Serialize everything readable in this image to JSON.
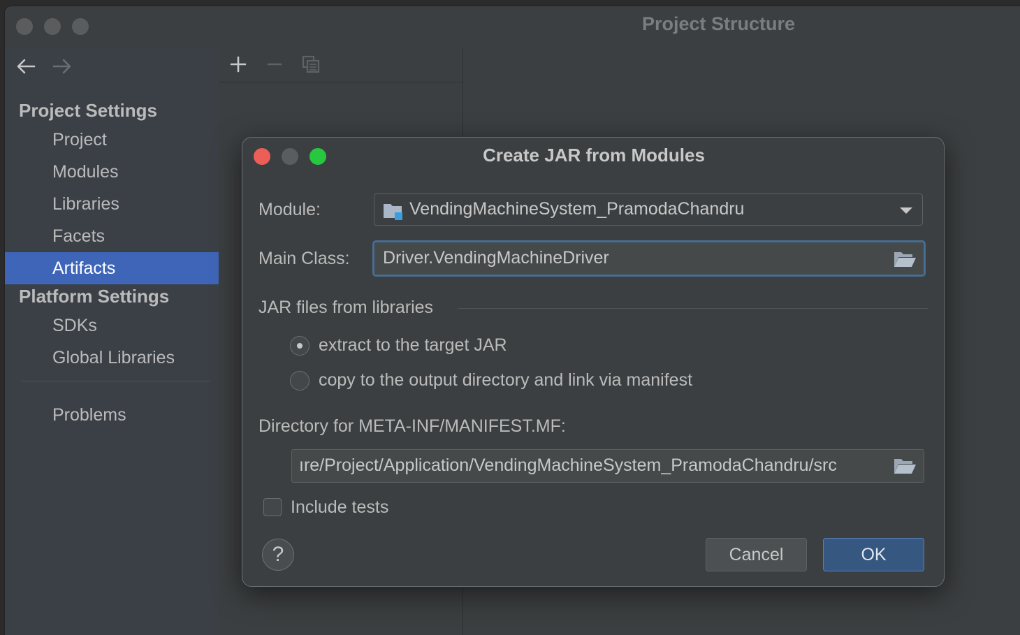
{
  "window": {
    "title": "Project Structure"
  },
  "sidebar": {
    "project_settings_header": "Project Settings",
    "project_items": [
      {
        "label": "Project"
      },
      {
        "label": "Modules"
      },
      {
        "label": "Libraries"
      },
      {
        "label": "Facets"
      },
      {
        "label": "Artifacts",
        "selected": true
      }
    ],
    "platform_settings_header": "Platform Settings",
    "platform_items": [
      {
        "label": "SDKs"
      },
      {
        "label": "Global Libraries"
      }
    ],
    "problems_label": "Problems"
  },
  "toolbar": {
    "icons": [
      "add-icon",
      "remove-icon",
      "copy-icon"
    ]
  },
  "dialog": {
    "title": "Create JAR from Modules",
    "module_label": "Module:",
    "module_value": "VendingMachineSystem_PramodaChandru",
    "main_class_label": "Main Class:",
    "main_class_value": "Driver.VendingMachineDriver",
    "jar_files_header": "JAR files from libraries",
    "radio_extract_label": "extract to the target JAR",
    "radio_copy_label": "copy to the output directory and link via manifest",
    "selected_radio": "extract",
    "manifest_dir_label": "Directory for META-INF/MANIFEST.MF:",
    "manifest_dir_value": "ıre/Project/Application/VendingMachineSystem_PramodaChandru/src",
    "include_tests_label": "Include tests",
    "include_tests_checked": false,
    "help_label": "?",
    "cancel_label": "Cancel",
    "ok_label": "OK"
  },
  "colors": {
    "selection": "#3f65b8",
    "focus_border": "#466d94",
    "ok_button": "#365880",
    "close": "#ec5f57",
    "zoom": "#27c840"
  }
}
